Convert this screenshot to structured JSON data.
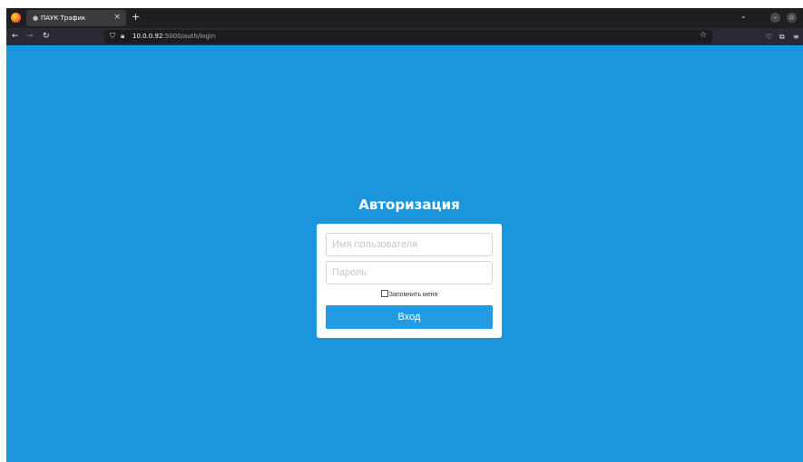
{
  "browser": {
    "tab": {
      "title": "ПАУК Трафик",
      "close_glyph": "×"
    },
    "new_tab_glyph": "+",
    "url": {
      "host": "10.0.0.92",
      "path": ":5000/auth/login"
    },
    "icons": {
      "app_logo": "firefox-icon",
      "tab_favicon": "dot-icon",
      "back": "arrow-left-icon",
      "forward": "arrow-right-icon",
      "reload": "reload-icon",
      "shield": "shield-icon",
      "lock": "lock-icon",
      "bookmark": "star-icon",
      "pocket": "pocket-icon",
      "extensions": "puzzle-icon",
      "menu": "hamburger-icon",
      "list_tabs": "chevron-down-icon"
    }
  },
  "login": {
    "title": "Авторизация",
    "username_placeholder": "Имя пользователя",
    "password_placeholder": "Пароль",
    "remember_label": "Запомнить меня",
    "submit_label": "Вход"
  },
  "colors": {
    "page_background": "#1b96dc",
    "button_background": "#229ae4",
    "browser_chrome": "#1f1e25"
  }
}
